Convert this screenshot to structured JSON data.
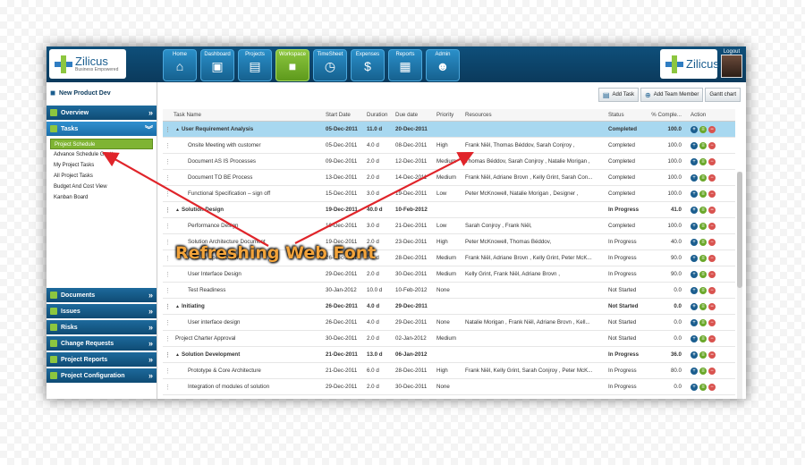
{
  "header": {
    "logo_title": "Zilicus",
    "logo_tagline": "Business Empowered",
    "nav": [
      {
        "label": "Home",
        "icon": "home-icon",
        "glyph": "⌂"
      },
      {
        "label": "Dashboard",
        "icon": "monitor-icon",
        "glyph": "▣"
      },
      {
        "label": "Projects",
        "icon": "projector-icon",
        "glyph": "▤"
      },
      {
        "label": "Workspace",
        "icon": "briefcase-icon",
        "glyph": "■"
      },
      {
        "label": "TimeSheet",
        "icon": "clock-icon",
        "glyph": "◷"
      },
      {
        "label": "Expenses",
        "icon": "dollar-icon",
        "glyph": "$"
      },
      {
        "label": "Reports",
        "icon": "report-icon",
        "glyph": "▦"
      },
      {
        "label": "Admin",
        "icon": "user-icon",
        "glyph": "☻"
      }
    ],
    "right_logo_title": "Zilicus",
    "logout_label": "Logout"
  },
  "sidebar": {
    "project_name": "New Product Dev",
    "sections_top": [
      {
        "label": "Overview"
      },
      {
        "label": "Tasks"
      }
    ],
    "task_links": [
      "Project Schedule",
      "Advance Schedule Gantt",
      "My Project Tasks",
      "All Project Tasks",
      "Budget And Cost View",
      "Kanban Board"
    ],
    "sections_bottom": [
      {
        "label": "Documents"
      },
      {
        "label": "Issues"
      },
      {
        "label": "Risks"
      },
      {
        "label": "Change Requests"
      },
      {
        "label": "Project Reports"
      },
      {
        "label": "Project Configuration"
      }
    ]
  },
  "toolbar": {
    "add_task": "Add Task",
    "add_member": "Add Team Member",
    "gantt": "Gantt chart"
  },
  "grid": {
    "columns": {
      "name": "Task Name",
      "start": "Start Date",
      "duration": "Duration",
      "due": "Due date",
      "priority": "Priority",
      "resources": "Resources",
      "status": "Status",
      "pct": "% Comple...",
      "action": "Action"
    },
    "rows": [
      {
        "name": "User Requirement Analysis",
        "start": "05-Dec-2011",
        "dur": "11.0 d",
        "due": "20-Dec-2011",
        "pri": "",
        "res": "",
        "status": "Completed",
        "pct": "100.0"
      },
      {
        "name": "Onsite Meeting with customer",
        "start": "05-Dec-2011",
        "dur": "4.0 d",
        "due": "08-Dec-2011",
        "pri": "High",
        "res": "Frank Niël, Thomas Béddov, Sarah Conjroy ,",
        "status": "Completed",
        "pct": "100.0"
      },
      {
        "name": "Document AS IS Processes",
        "start": "09-Dec-2011",
        "dur": "2.0 d",
        "due": "12-Dec-2011",
        "pri": "Medium",
        "res": "Thomas Béddov, Sarah Conjroy , Natalie Morigan ,",
        "status": "Completed",
        "pct": "100.0"
      },
      {
        "name": "Document TO BE Process",
        "start": "13-Dec-2011",
        "dur": "2.0 d",
        "due": "14-Dec-2011",
        "pri": "Medium",
        "res": "Frank Niël, Adriane Brovn , Kelly Grint, Sarah Con...",
        "status": "Completed",
        "pct": "100.0"
      },
      {
        "name": "Functional Specification – sign off",
        "start": "15-Dec-2011",
        "dur": "3.0 d",
        "due": "19-Dec-2011",
        "pri": "Low",
        "res": "Peter McKnowell, Natalie Morigan , Designer ,",
        "status": "Completed",
        "pct": "100.0"
      },
      {
        "name": "Solution Design",
        "start": "19-Dec-2011",
        "dur": "40.0 d",
        "due": "10-Feb-2012",
        "pri": "",
        "res": "",
        "status": "In Progress",
        "pct": "41.0"
      },
      {
        "name": "Performance Design",
        "start": "19-Dec-2011",
        "dur": "3.0 d",
        "due": "21-Dec-2011",
        "pri": "Low",
        "res": "Sarah Conjroy , Frank Niël,",
        "status": "Completed",
        "pct": "100.0"
      },
      {
        "name": "Solution Architecture Document",
        "start": "19-Dec-2011",
        "dur": "2.0 d",
        "due": "23-Dec-2011",
        "pri": "High",
        "res": "Peter McKnowell, Thomas Béddov,",
        "status": "In Progress",
        "pct": "40.0"
      },
      {
        "name": "Feature Specification",
        "start": "26-Dec-2011",
        "dur": "3.0 d",
        "due": "28-Dec-2011",
        "pri": "Medium",
        "res": "Frank Niël, Adriane Brovn , Kelly Grint, Peter McK...",
        "status": "In Progress",
        "pct": "90.0"
      },
      {
        "name": "User Interface Design",
        "start": "29-Dec-2011",
        "dur": "2.0 d",
        "due": "30-Dec-2011",
        "pri": "Medium",
        "res": "Kelly Grint, Frank Niël, Adriane Brovn ,",
        "status": "In Progress",
        "pct": "90.0"
      },
      {
        "name": "Test Readiness",
        "start": "30-Jan-2012",
        "dur": "10.0 d",
        "due": "10-Feb-2012",
        "pri": "None",
        "res": "",
        "status": "Not Started",
        "pct": "0.0"
      },
      {
        "name": "Initiating",
        "start": "26-Dec-2011",
        "dur": "4.0 d",
        "due": "29-Dec-2011",
        "pri": "",
        "res": "",
        "status": "Not Started",
        "pct": "0.0"
      },
      {
        "name": "User interface design",
        "start": "26-Dec-2011",
        "dur": "4.0 d",
        "due": "29-Dec-2011",
        "pri": "None",
        "res": "Natalie Morigan , Frank Niël, Adriane Brovn , Kell...",
        "status": "Not Started",
        "pct": "0.0"
      },
      {
        "name": "Project Charter Approval",
        "start": "30-Dec-2011",
        "dur": "2.0 d",
        "due": "02-Jan-2012",
        "pri": "Medium",
        "res": "",
        "status": "Not Started",
        "pct": "0.0"
      },
      {
        "name": "Solution Development",
        "start": "21-Dec-2011",
        "dur": "13.0 d",
        "due": "06-Jan-2012",
        "pri": "",
        "res": "",
        "status": "In Progress",
        "pct": "36.0"
      },
      {
        "name": "Prototype & Core Architecture",
        "start": "21-Dec-2011",
        "dur": "6.0 d",
        "due": "28-Dec-2011",
        "pri": "High",
        "res": "Frank Niël, Kelly Grint, Sarah Conjroy , Peter McK...",
        "status": "In Progress",
        "pct": "80.0"
      },
      {
        "name": "Integration of modules of solution",
        "start": "29-Dec-2011",
        "dur": "2.0 d",
        "due": "30-Dec-2011",
        "pri": "None",
        "res": "",
        "status": "In Progress",
        "pct": "0.0"
      }
    ]
  },
  "overlay": {
    "text": "Refreshing Web Font",
    "arrow_color": "#e0242a",
    "text_color": "#f2a33a"
  }
}
